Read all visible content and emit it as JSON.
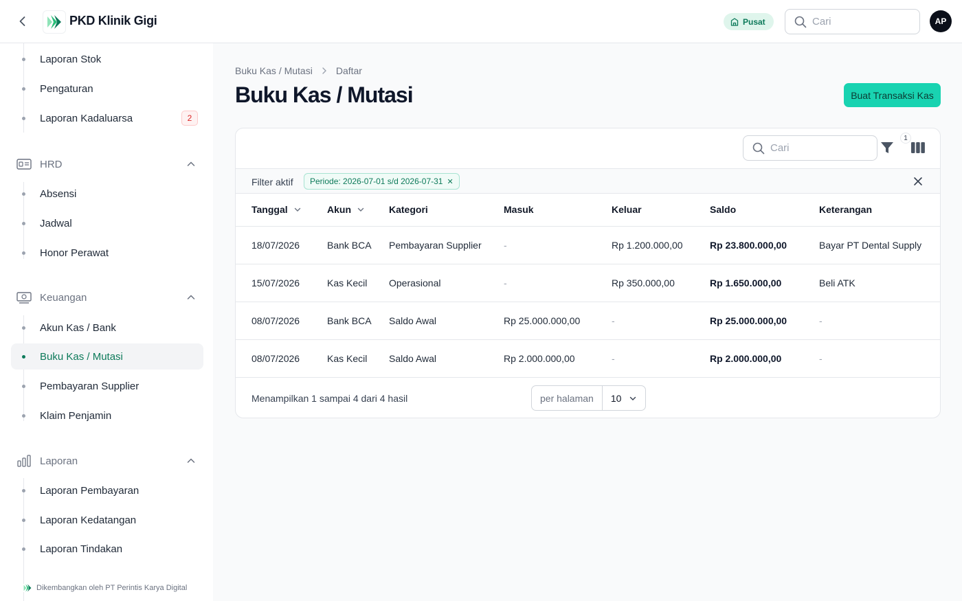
{
  "header": {
    "app_title": "PKD Klinik Gigi",
    "branch_label": "Pusat",
    "search_placeholder": "Cari",
    "avatar_initials": "AP",
    "brand_color": "#19d3b1"
  },
  "sidebar": {
    "items_top": [
      {
        "label": "Laporan Stok"
      },
      {
        "label": "Pengaturan"
      },
      {
        "label": "Laporan Kadaluarsa",
        "count": "2"
      }
    ],
    "groups": [
      {
        "label": "HRD",
        "icon": "id-card-icon",
        "items": [
          {
            "label": "Absensi"
          },
          {
            "label": "Jadwal"
          },
          {
            "label": "Honor Perawat"
          }
        ]
      },
      {
        "label": "Keuangan",
        "icon": "money-icon",
        "items": [
          {
            "label": "Akun Kas / Bank"
          },
          {
            "label": "Buku Kas / Mutasi",
            "active": true
          },
          {
            "label": "Pembayaran Supplier"
          },
          {
            "label": "Klaim Penjamin"
          }
        ]
      },
      {
        "label": "Laporan",
        "icon": "bar-chart-icon",
        "items": [
          {
            "label": "Laporan Pembayaran"
          },
          {
            "label": "Laporan Kedatangan"
          },
          {
            "label": "Laporan Tindakan"
          }
        ]
      }
    ],
    "footer": "Dikembangkan oleh PT Perintis Karya Digital"
  },
  "main": {
    "breadcrumb": [
      "Buku Kas / Mutasi",
      "Daftar"
    ],
    "title": "Buku Kas / Mutasi",
    "create_button": "Buat Transaksi Kas",
    "table_search_placeholder": "Cari",
    "filter_count": "1",
    "filter_bar": {
      "label": "Filter aktif",
      "chip": "Periode: 2026-07-01 s/d 2026-07-31"
    },
    "columns": [
      "Tanggal",
      "Akun",
      "Kategori",
      "Masuk",
      "Keluar",
      "Saldo",
      "Keterangan"
    ],
    "rows": [
      [
        "18/07/2026",
        "Bank BCA",
        "Pembayaran Supplier",
        "-",
        "Rp 1.200.000,00",
        "Rp 23.800.000,00",
        "Bayar PT Dental Supply"
      ],
      [
        "15/07/2026",
        "Kas Kecil",
        "Operasional",
        "-",
        "Rp 350.000,00",
        "Rp 1.650.000,00",
        "Beli ATK"
      ],
      [
        "08/07/2026",
        "Bank BCA",
        "Saldo Awal",
        "Rp 25.000.000,00",
        "-",
        "Rp 25.000.000,00",
        "-"
      ],
      [
        "08/07/2026",
        "Kas Kecil",
        "Saldo Awal",
        "Rp 2.000.000,00",
        "-",
        "Rp 2.000.000,00",
        "-"
      ]
    ],
    "footer_info": "Menampilkan 1 sampai 4 dari 4 hasil",
    "per_page_label": "per halaman",
    "per_page_value": "10"
  }
}
